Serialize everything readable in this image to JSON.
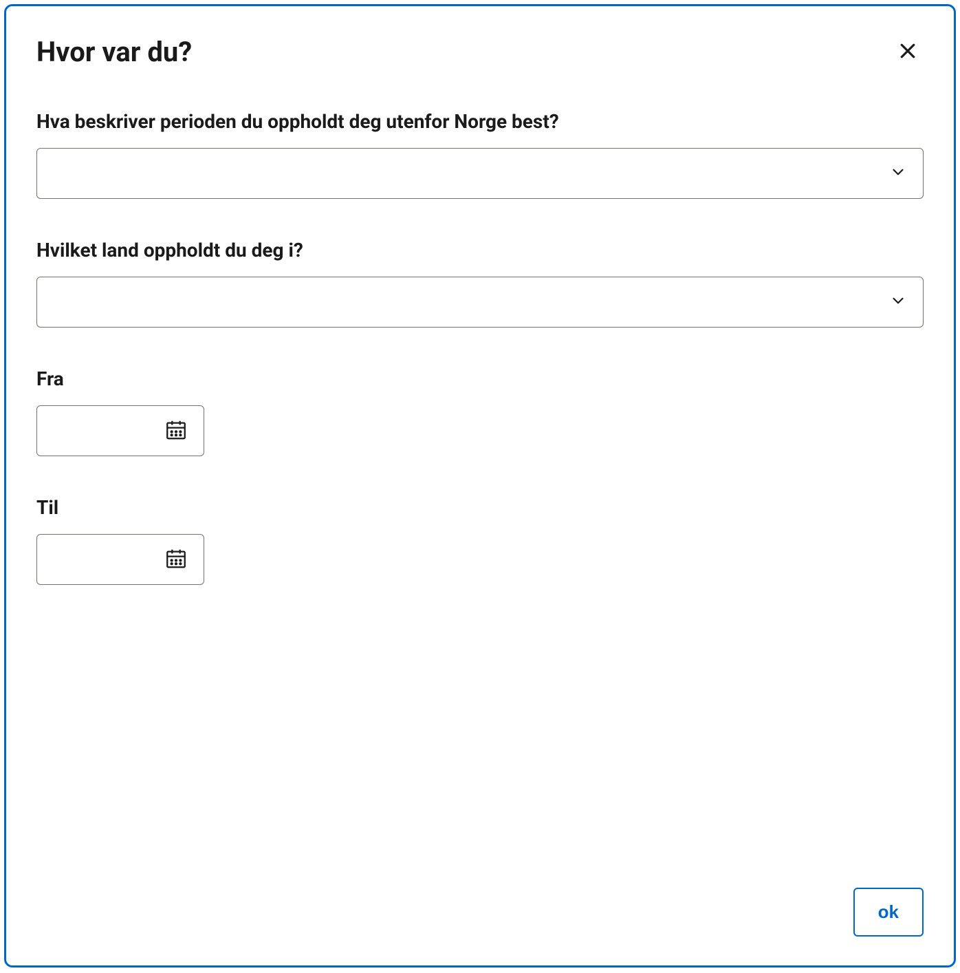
{
  "modal": {
    "title": "Hvor var du?",
    "period": {
      "label": "Hva beskriver perioden du oppholdt deg utenfor Norge best?",
      "value": ""
    },
    "country": {
      "label": "Hvilket land oppholdt du deg i?",
      "value": ""
    },
    "from": {
      "label": "Fra",
      "value": ""
    },
    "to": {
      "label": "Til",
      "value": ""
    },
    "ok_label": "ok"
  }
}
